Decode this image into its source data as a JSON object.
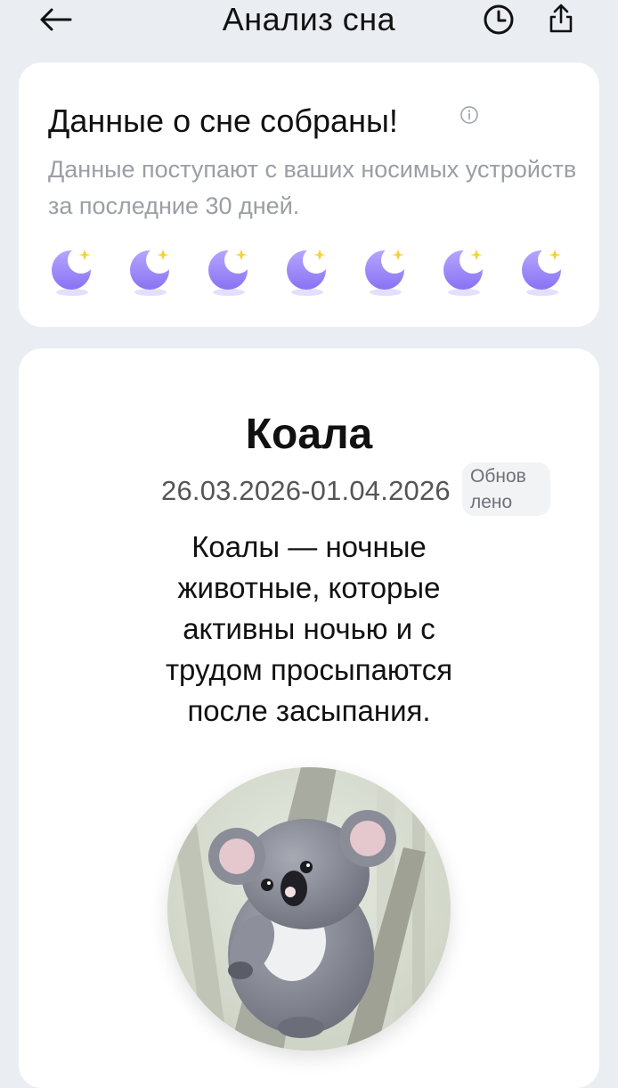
{
  "header": {
    "title": "Анализ сна"
  },
  "summary_card": {
    "title": "Данные о сне собраны!",
    "subtitle": "Данные поступают с ваших носимых устройств за последние 30 дней.",
    "moon_count": 7,
    "moon_color": "#8a72f3",
    "star_color": "#f5d23a"
  },
  "result_card": {
    "animal_name": "Коала",
    "date_range": "26.03.2026-01.04.2026",
    "updated_badge_line1": "Обнов",
    "updated_badge_line2": "лено",
    "description": "Коалы — ночные животные, которые активны ночью и с трудом просыпаются после засыпания."
  },
  "icons": {
    "back": "arrow-left-icon",
    "history": "clock-icon",
    "share": "share-icon",
    "info": "info-icon",
    "moon": "moon-star-icon"
  }
}
